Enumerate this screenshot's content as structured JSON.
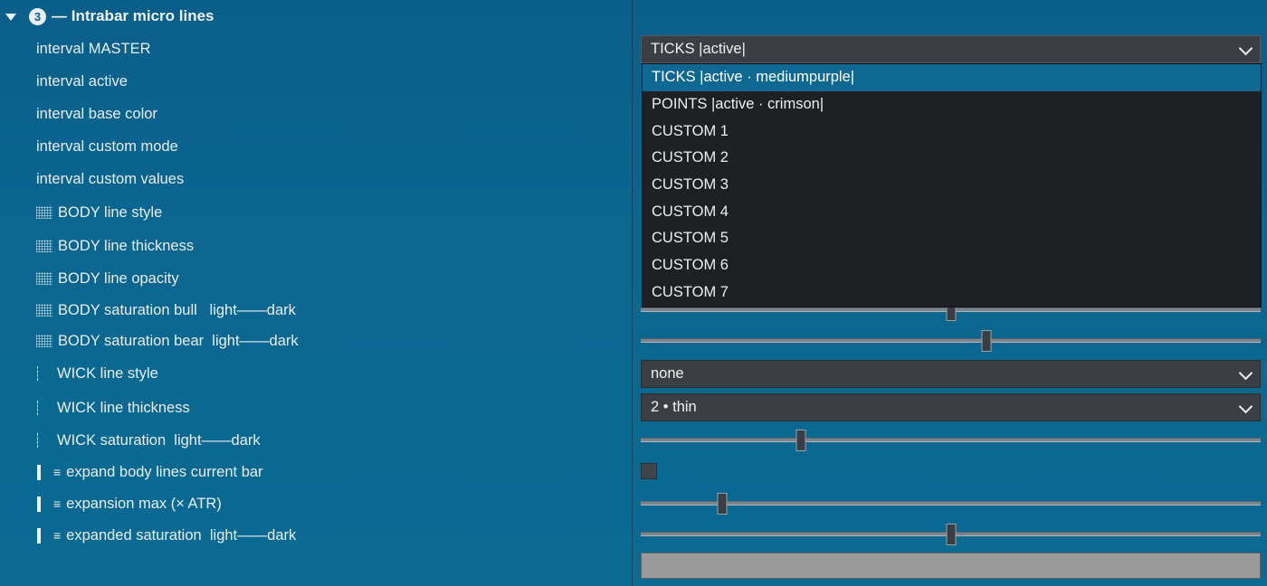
{
  "section": {
    "number": "3",
    "title": "— Intrabar micro lines"
  },
  "labels": [
    {
      "text": "interval MASTER"
    },
    {
      "text": "interval active"
    },
    {
      "text": "interval base color"
    },
    {
      "text": "interval custom mode"
    },
    {
      "text": "interval custom values"
    },
    {
      "text": "BODY line style"
    },
    {
      "text": "BODY line thickness"
    },
    {
      "text": "BODY line opacity"
    },
    {
      "text": "BODY saturation bull   light——dark"
    },
    {
      "text": "BODY saturation bear  light——dark"
    },
    {
      "text": "WICK line style"
    },
    {
      "text": "WICK line thickness"
    },
    {
      "text": "WICK saturation  light——dark"
    },
    {
      "text": "expand body lines current bar"
    },
    {
      "text": "expansion max (× ATR)"
    },
    {
      "text": "expanded saturation  light——dark"
    }
  ],
  "lines_icon_glyph": "≡",
  "master_dropdown": {
    "value": "TICKS |active|",
    "options": [
      "TICKS |active · mediumpurple|",
      "POINTS |active · crimson|",
      "CUSTOM 1",
      "CUSTOM 2",
      "CUSTOM 3",
      "CUSTOM 4",
      "CUSTOM 5",
      "CUSTOM 6",
      "CUSTOM 7"
    ],
    "highlighted_index": 0
  },
  "wick_line_style": {
    "value": "none"
  },
  "wick_line_thickness": {
    "value": "2 • thin"
  },
  "sliders": {
    "body_saturation_bull": 0.5,
    "body_saturation_bear": 0.557,
    "wick_saturation": 0.258,
    "expansion_max": 0.131,
    "expanded_saturation": 0.5
  },
  "expand_body_lines_current_bar": false,
  "expanded_saturation_text": "",
  "colors": {
    "selected": "#0e6892",
    "menu_bg": "#1f2023",
    "control_bg": "#3b3f44"
  }
}
